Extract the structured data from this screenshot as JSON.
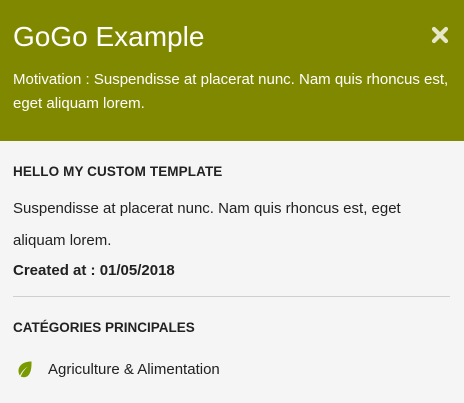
{
  "header": {
    "title": "GoGo Example",
    "motivation": "Motivation : Suspendisse at placerat nunc. Nam quis rhoncus est, eget aliquam lorem.",
    "close_icon": "close-icon",
    "bg_color": "#808800"
  },
  "template": {
    "heading": "HELLO MY CUSTOM TEMPLATE",
    "description": "Suspendisse at placerat nunc. Nam quis rhoncus est, eget aliquam lorem.",
    "created": "Created at : 01/05/2018"
  },
  "categories": {
    "heading": "CATÉGORIES PRINCIPALES",
    "items": [
      {
        "label": "Agriculture & Alimentation",
        "icon": "leaf-icon",
        "icon_color": "#7a9a01"
      }
    ]
  }
}
